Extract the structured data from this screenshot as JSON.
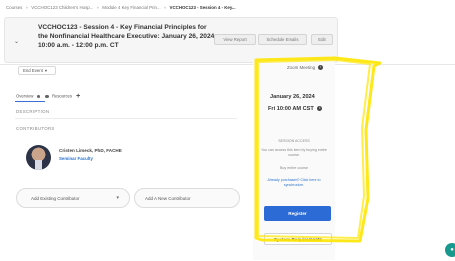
{
  "breadcrumb": {
    "items": [
      "Courses",
      "VCCHOC123 Children's Hosp...",
      "Module 4 Key Financial Prin...",
      "VCCHOC123 - Session 4 - Key..."
    ],
    "sep": "»"
  },
  "header": {
    "title": "VCCHOC123 - Session 4 - Key Financial Principles for the Nonfinancial Healthcare Executive: January 26, 2024, 10:00 a.m. - 12:00 p.m. CT",
    "buttons": {
      "view_report": "View Report",
      "schedule_emails": "Schedule Emails",
      "edit": "Edit"
    }
  },
  "toolbar": {
    "end_event": "End Event",
    "zoom_meeting": "Zoom Meeting"
  },
  "tabs": {
    "overview": "Overview",
    "resources": "Resources",
    "add": "+"
  },
  "sections": {
    "description": "DESCRIPTION",
    "contributors": "CONTRIBUTORS"
  },
  "contributor": {
    "name": "Cristen Limeck, PhD, FACHE",
    "role": "Seminar Faculty"
  },
  "actions": {
    "add_existing": "Add Existing Contributor",
    "add_new": "Add A New Contributor"
  },
  "event": {
    "date": "January 26, 2024",
    "time": "Fri 10:00 AM CST",
    "status": "SESSION ACCESS",
    "access_note": "You can access this item by buying entire course.",
    "buy": "Buy entire course",
    "already_purchased": "Already purchased? Click here to synchronize.",
    "register": "Register",
    "system_requirements": "System Requirements"
  },
  "colors": {
    "accent": "#2c6ad6",
    "highlight": "#ffe500",
    "link": "#2b73c9",
    "chat": "#17998e"
  }
}
